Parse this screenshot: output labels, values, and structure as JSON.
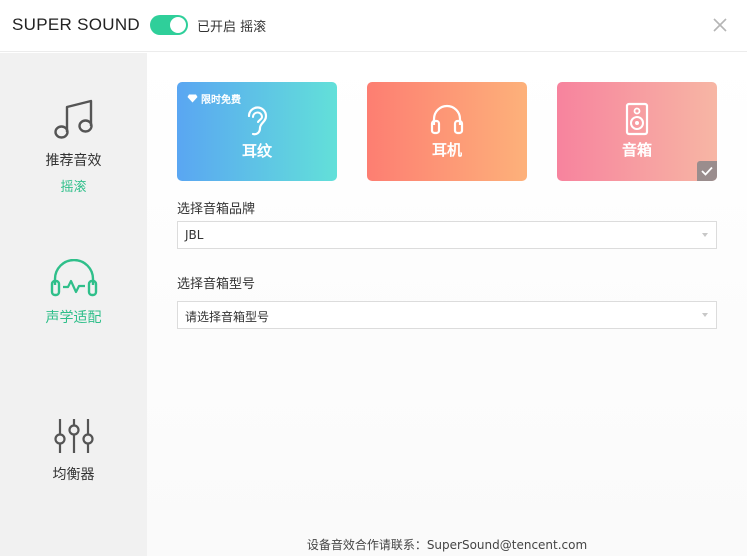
{
  "titlebar": {
    "app_title": "SUPER SOUND",
    "toggle_on": true,
    "toggle_status": "已开启 摇滚"
  },
  "sidebar": {
    "items": [
      {
        "label": "推荐音效",
        "sub": "摇滚",
        "icon": "music-note-icon",
        "active": false
      },
      {
        "label": "声学适配",
        "icon": "headphone-wave-icon",
        "active": true
      },
      {
        "label": "均衡器",
        "icon": "equalizer-icon",
        "active": false
      }
    ]
  },
  "devices": {
    "cards": [
      {
        "label": "耳纹",
        "icon": "ear-icon",
        "badge": "限时免费",
        "selected": false
      },
      {
        "label": "耳机",
        "icon": "headphone-icon",
        "selected": false
      },
      {
        "label": "音箱",
        "icon": "speaker-icon",
        "selected": true
      }
    ]
  },
  "form": {
    "brand_label": "选择音箱品牌",
    "brand_value": "JBL",
    "model_label": "选择音箱型号",
    "model_placeholder": "请选择音箱型号"
  },
  "footer": {
    "text": "设备音效合作请联系：SuperSound@tencent.com"
  },
  "colors": {
    "accent": "#2fbf8a",
    "ear_card": [
      "#5aa6f2",
      "#62e0d9"
    ],
    "headphone_card": [
      "#fd7e72",
      "#fdb17a"
    ],
    "speaker_card": [
      "#f7839e",
      "#f7b6a4"
    ]
  }
}
